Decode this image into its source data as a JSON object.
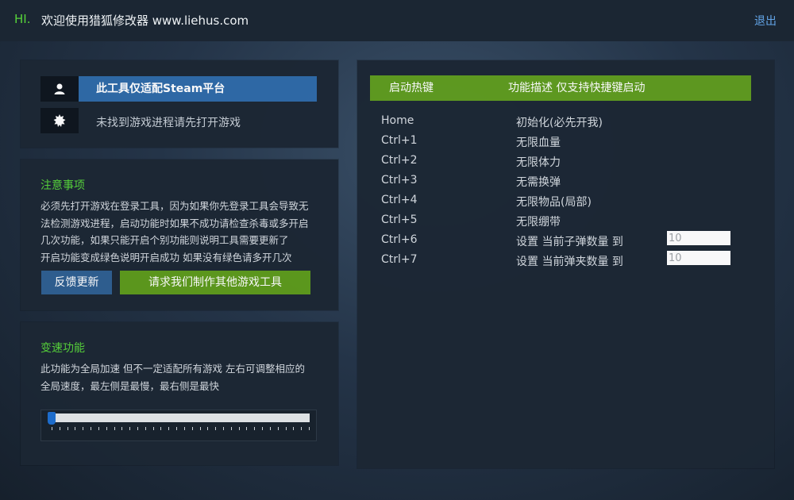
{
  "titlebar": {
    "hi": "HI.",
    "welcome": "欢迎使用猎狐修改器 www.liehus.com",
    "exit": "退出"
  },
  "status": {
    "steam_notice": "此工具仅适配Steam平台",
    "process_status": "未找到游戏进程请先打开游戏",
    "user_icon": "user-icon",
    "status_icon": "gear-icon"
  },
  "notes": {
    "title": "注意事项",
    "lines": [
      "必须先打开游戏在登录工具，因为如果你先登录工具会导致无",
      "法检测游戏进程，启动功能时如果不成功请检查杀毒或多开启",
      "几次功能，如果只能开启个别功能则说明工具需要更新了",
      "开启功能变成绿色说明开启成功 如果没有绿色请多开几次"
    ],
    "feedback_button": "反馈更新",
    "request_button": "请求我们制作其他游戏工具"
  },
  "speed": {
    "title": "变速功能",
    "lines": [
      "此功能为全局加速 但不一定适配所有游戏 左右可调整相应的",
      "全局速度，最左侧是最慢，最右侧是最快"
    ],
    "slider_value": 0
  },
  "hotkeys": {
    "header_key": "启动热键",
    "header_desc": "功能描述 仅支持快捷键启动",
    "rows": [
      {
        "key": "Home",
        "desc": "初始化(必先开我)"
      },
      {
        "key": "Ctrl+1",
        "desc": "无限血量"
      },
      {
        "key": "Ctrl+2",
        "desc": "无限体力"
      },
      {
        "key": "Ctrl+3",
        "desc": "无需换弹"
      },
      {
        "key": "Ctrl+4",
        "desc": "无限物品(局部)"
      },
      {
        "key": "Ctrl+5",
        "desc": "无限绷带"
      },
      {
        "key": "Ctrl+6",
        "desc": "设置 当前子弹数量 到",
        "value": "10"
      },
      {
        "key": "Ctrl+7",
        "desc": "设置 当前弹夹数量 到",
        "value": "10"
      }
    ]
  },
  "colors": {
    "accent_green": "#5f9b1f",
    "accent_blue": "#2f6aa8",
    "title_green": "#57d43a",
    "link_blue": "#63a5e8"
  }
}
